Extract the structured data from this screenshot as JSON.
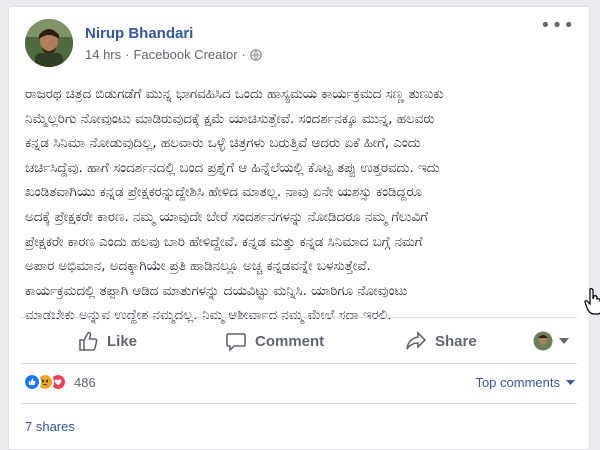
{
  "post": {
    "author": "Nirup Bhandari",
    "time": "14 hrs",
    "separator": "·",
    "role": "Facebook Creator",
    "text": "ರಾಜರಥ ಚಿತ್ರದ ಬಿಡುಗಡೆಗೆ ಮುನ್ನ ಭಾಗವಹಿಸಿದ ಒಂದು ಹಾಸ್ಯಮಯ ಕಾರ್ಯಕ್ರಮದ ಸಣ್ಣ ತುಣುಕು\nನಿಮ್ಮೆಲ್ಲರಿಗು ನೋವುಂಟು ಮಾಡಿರುವುದಕ್ಕೆ ಕ್ಷಮೆ ಯಾಚಿಸುತ್ತೇವೆ. ಸಂದರ್ಶನಕ್ಕೂ ಮುನ್ನ, ಹಲವರು\nಕನ್ನಡ ಸಿನಿಮಾ ನೋಡುವುದಿಲ್ಲ, ಹಲವಾರು ಒಳ್ಳೆ ಚಿತ್ರಗಳು ಬರುತ್ತಿವೆ ಆದರು ಏಕೆ ಹೀಗೆ, ಎಂದು\nಚರ್ಚಿಸಿದ್ದೆವು. ಹಾಗೆ ಸಂದರ್ಶನದಲ್ಲಿ ಬಂದ ಪ್ರಶ್ನೆಗೆ ಆ ಹಿನ್ನೆಲೆಯಲ್ಲಿ ಕೊಟ್ಟ ತಪ್ಪು ಉತ್ತರವದು. ಇದು\nಖಂಡಿತವಾಗಿಯು ಕನ್ನಡ ಪ್ರೇಕ್ಷಕರನ್ನುದ್ದೇಶಿಸಿ ಹೇಳಿದ ಮಾತಲ್ಲ. ನಾವು ಏನೇ ಯಶಸ್ಸು ಕಂಡಿದ್ದರೂ\nಅದಕ್ಕೆ ಪ್ರೇಕ್ಷಕರೇ ಕಾರಣ. ನಮ್ಮ ಯಾವುದೇ ಬೇರೆ ಸಂದರ್ಶನಗಳನ್ನು ನೋಡಿದರೂ ನಮ್ಮ ಗೆಲುವಿಗೆ\nಪ್ರೇಕ್ಷಕರೇ ಕಾರಣ ಎಂದು ಹಲವು ಬಾರಿ ಹೇಳಿದ್ದೇವೆ. ಕನ್ನಡ ಮತ್ತು ಕನ್ನಡ ಸಿನಿಮಾದ ಬಗ್ಗೆ ನಮಗೆ\nಅಪಾರ ಅಭಿಮಾನ, ಅದಕ್ಕಾಗಿಯೇ ಪ್ರತಿ ಹಾಡಿನಲ್ಲೂ ಅಚ್ಚ ಕನ್ನಡವನ್ನೇ ಬಳಸುತ್ತೇವೆ.\nಕಾರ್ಯಕ್ರಮದಲ್ಲಿ ತಪ್ಪಾಗಿ ಆಡಿದ ಮಾತುಗಳನ್ನು ದಯವಿಟ್ಟು ಮನ್ನಿಸಿ. ಯಾರಿಗೂ ನೋವುಂಟು\nಮಾಡಬೇಕು ಅನ್ನುವ ಉದ್ದೇಶ ನಮ್ಮದಲ್ಲ. ನಿಮ್ಮ ಆಶೀರ್ವಾದ ನಮ್ಮ ಮೇಲೆ ಸದಾ ಇರಲಿ."
  },
  "actions": {
    "like": "Like",
    "comment": "Comment",
    "share": "Share"
  },
  "reactions": {
    "count": "486",
    "top_comments": "Top comments",
    "shares": "7 shares"
  },
  "icons": {
    "like": "thumbs-up-icon",
    "comment": "speech-bubble-icon",
    "share": "share-arrow-icon",
    "globe": "globe-icon",
    "more": "ellipsis-icon"
  },
  "colors": {
    "link": "#365899",
    "like_blue": "#1877f2",
    "angry": "#f0a830",
    "love": "#f33e58"
  }
}
